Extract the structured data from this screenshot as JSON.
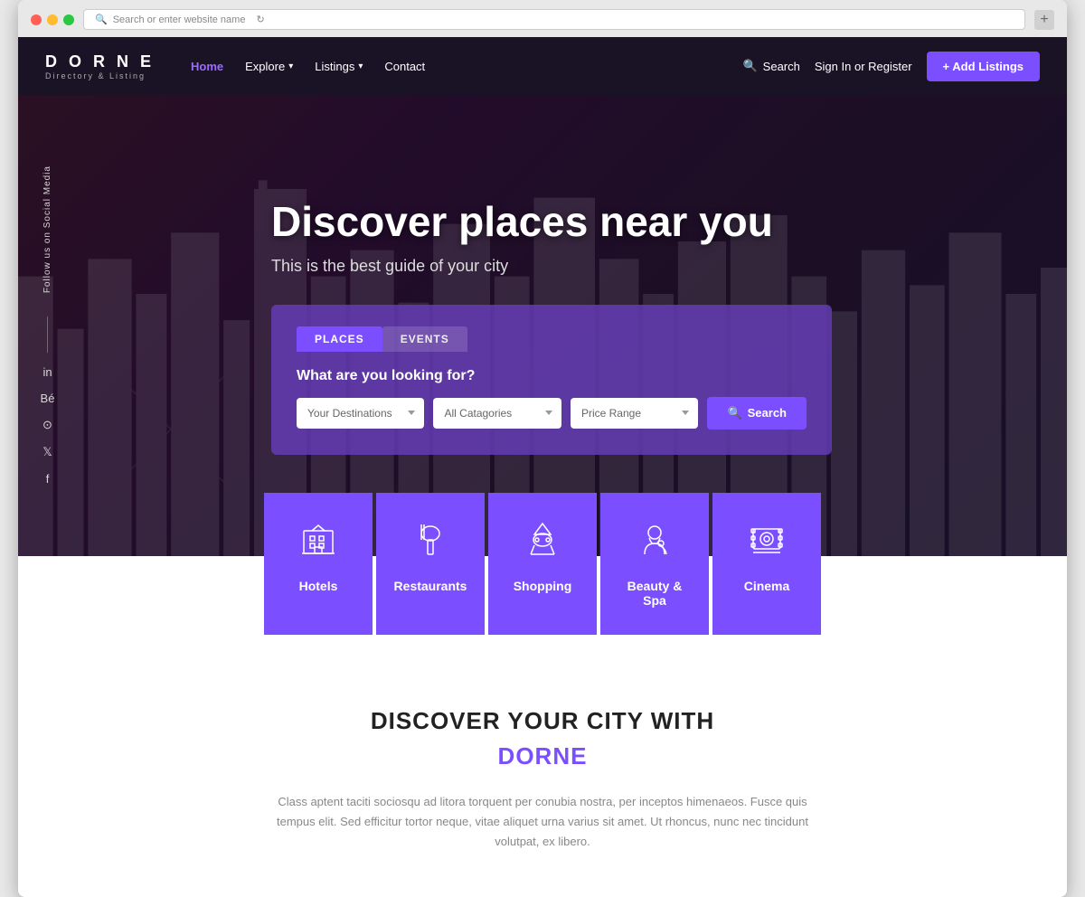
{
  "browser": {
    "address_placeholder": "Search or enter website name",
    "new_tab_icon": "+"
  },
  "header": {
    "logo_title": "D O R N E",
    "logo_subtitle": "Directory & Listing",
    "nav": [
      {
        "label": "Home",
        "active": true,
        "dropdown": false
      },
      {
        "label": "Explore",
        "active": false,
        "dropdown": true
      },
      {
        "label": "Listings",
        "active": false,
        "dropdown": true
      },
      {
        "label": "Contact",
        "active": false,
        "dropdown": false
      }
    ],
    "search_label": "Search",
    "signin_label": "Sign In or Register",
    "add_button": "+ Add Listings"
  },
  "hero": {
    "title": "Discover places near you",
    "subtitle": "This is the best guide of your city",
    "social_label": "Follow us on Social Media",
    "social_icons": [
      "in",
      "Bé",
      "⚙",
      "🐦",
      "f"
    ]
  },
  "search": {
    "tabs": [
      {
        "label": "PLACES",
        "active": true
      },
      {
        "label": "EVENTS",
        "active": false
      }
    ],
    "question": "What are you looking for?",
    "fields": [
      {
        "placeholder": "Your Destinations",
        "options": [
          "Your Destinations"
        ]
      },
      {
        "placeholder": "All Catagories",
        "options": [
          "All Catagories"
        ]
      },
      {
        "placeholder": "Price Range",
        "options": [
          "Price Range"
        ]
      }
    ],
    "button_label": "Search"
  },
  "categories": [
    {
      "label": "Hotels",
      "icon": "hotel"
    },
    {
      "label": "Restaurants",
      "icon": "restaurant"
    },
    {
      "label": "Shopping",
      "icon": "shopping"
    },
    {
      "label": "Beauty & Spa",
      "icon": "beauty"
    },
    {
      "label": "Cinema",
      "icon": "cinema"
    }
  ],
  "discover_section": {
    "heading_line1": "DISCOVER YOUR CITY WITH",
    "heading_line2": "DORNE",
    "description": "Class aptent taciti sociosqu ad litora torquent per conubia nostra, per inceptos himenaeos. Fusce quis tempus elit. Sed efficitur tortor neque, vitae aliquet urna varius sit amet. Ut rhoncus, nunc nec tincidunt volutpat, ex libero."
  }
}
